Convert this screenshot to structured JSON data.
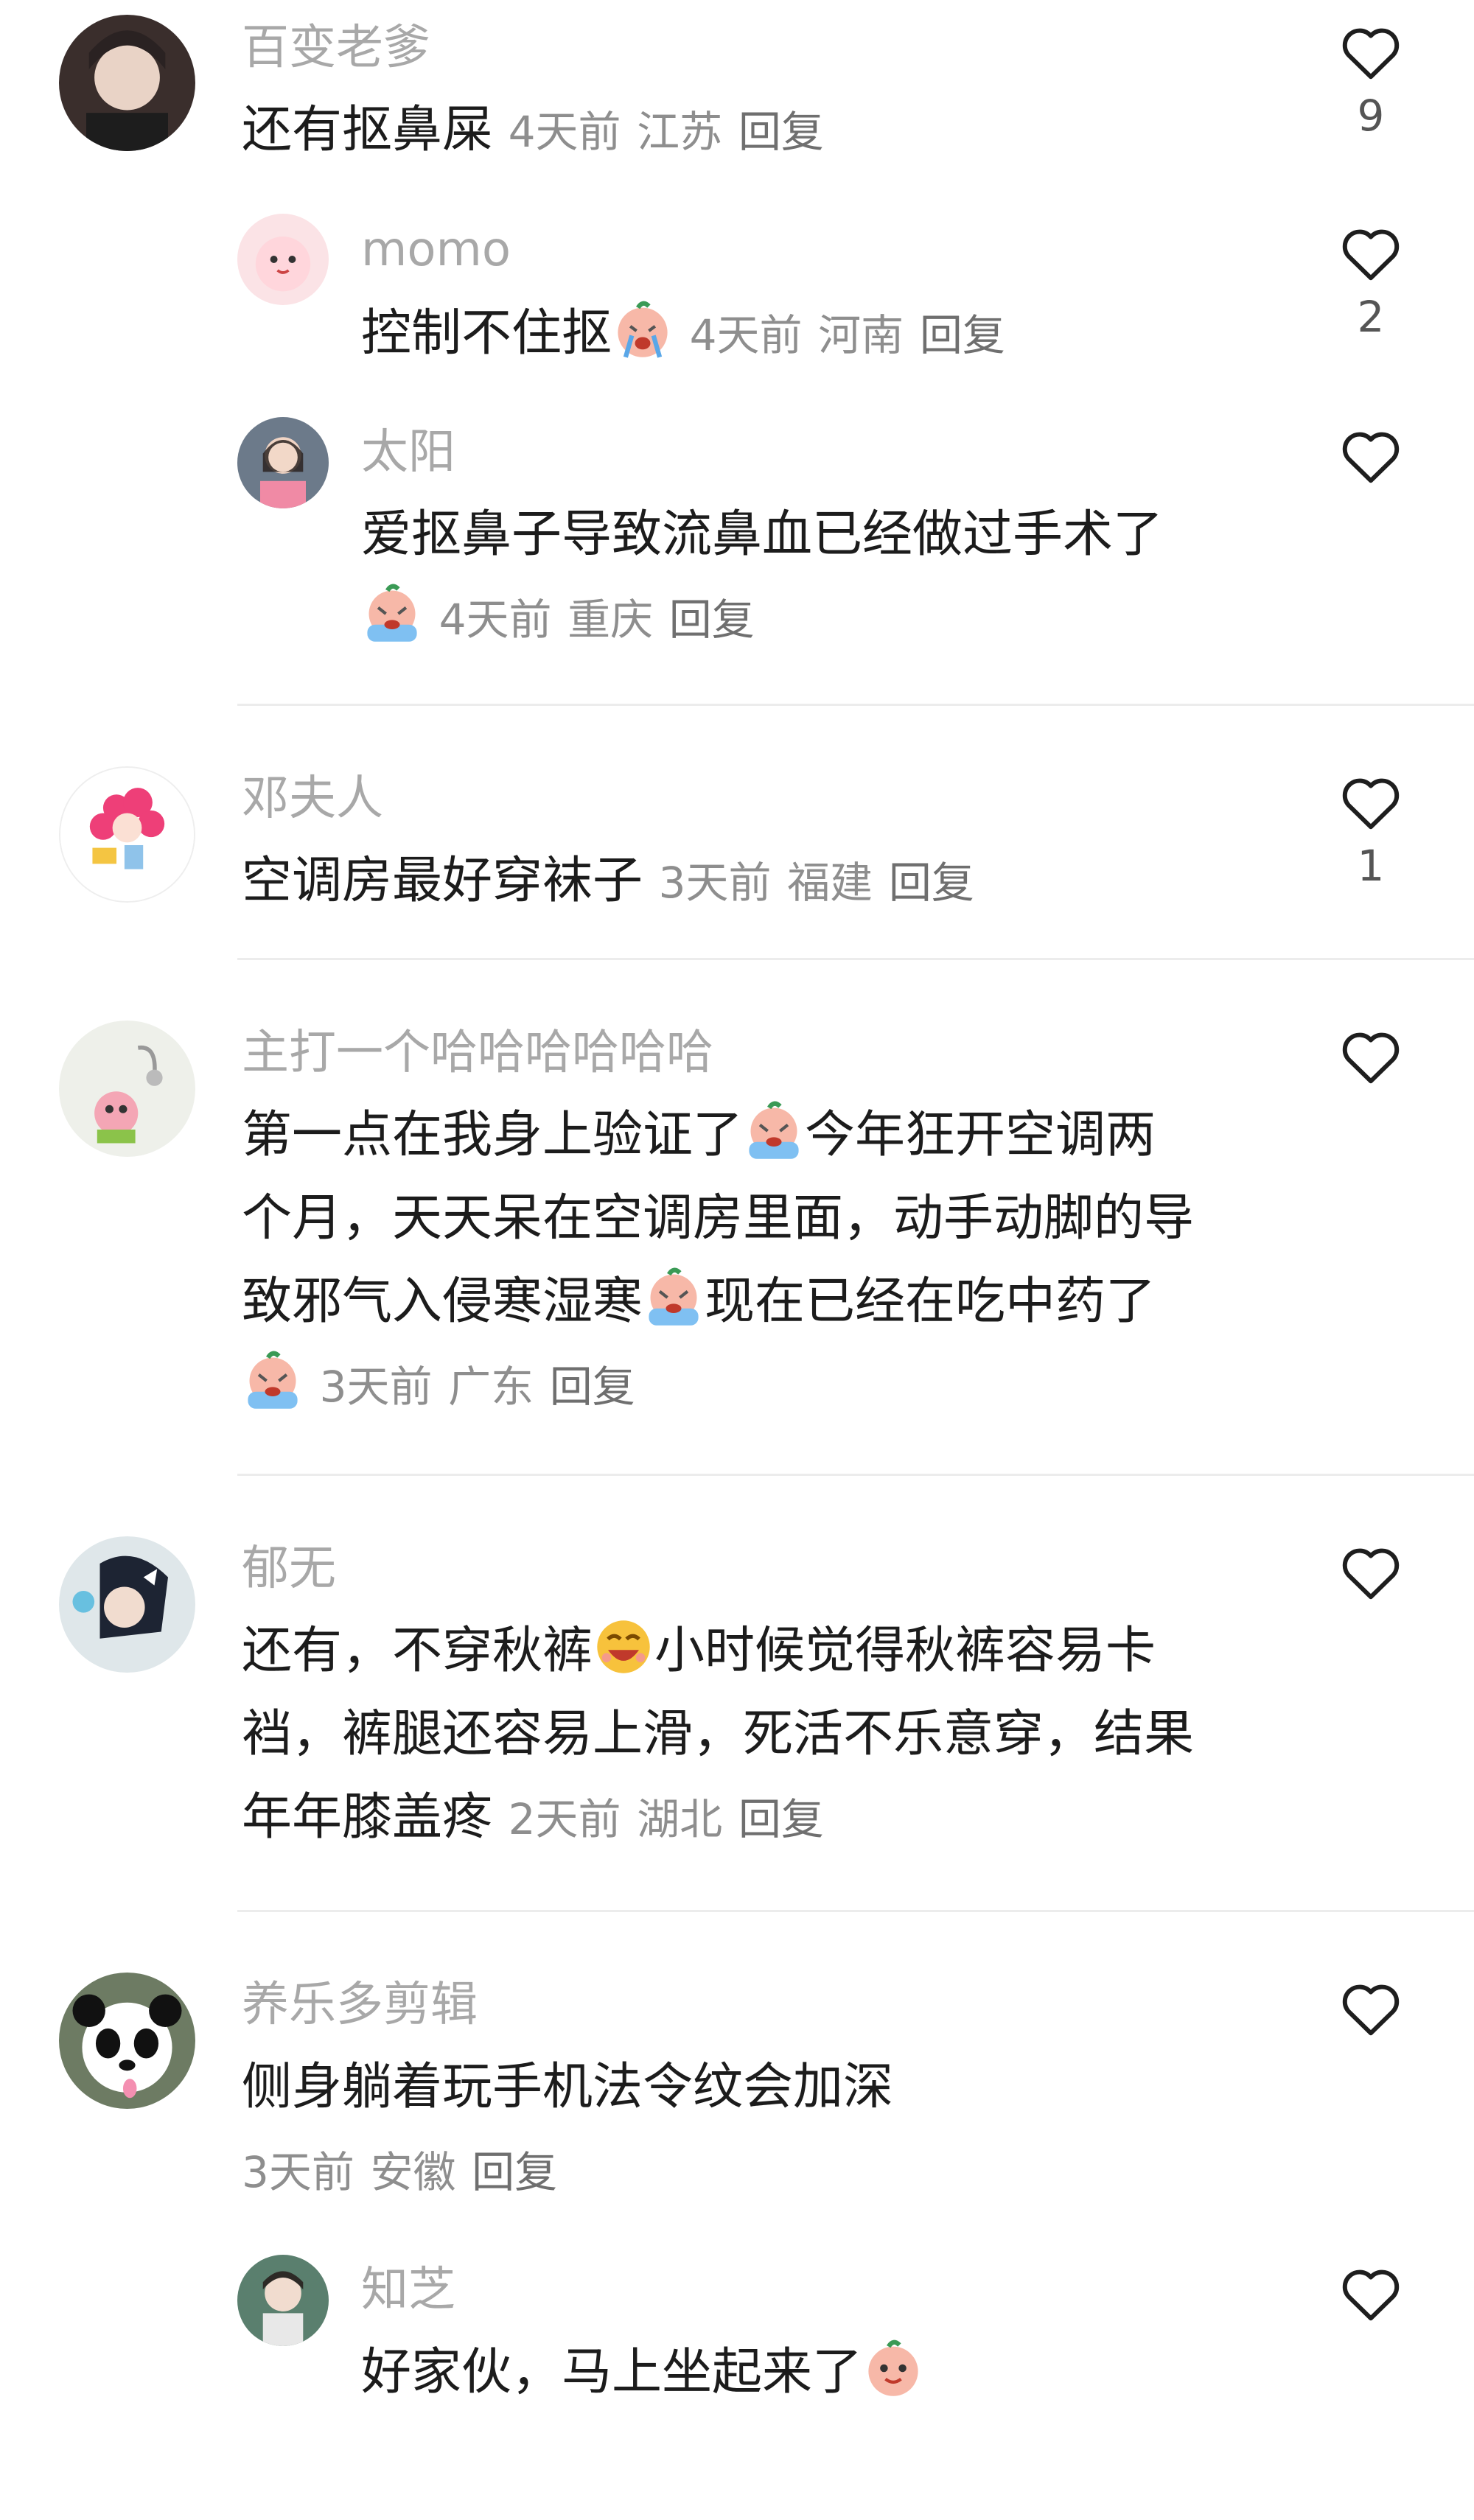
{
  "comments": [
    {
      "name": "百变老爹",
      "text": "还有抠鼻屎",
      "time": "4天前",
      "location": "江苏",
      "reply": "回复",
      "likes": "9"
    },
    {
      "name": "momo",
      "text": "控制不住抠",
      "time": "4天前",
      "location": "河南",
      "reply": "回复",
      "likes": "2"
    },
    {
      "name": "太阳",
      "text": "爱抠鼻子导致流鼻血已经做过手术了",
      "time": "4天前",
      "location": "重庆",
      "reply": "回复",
      "likes": ""
    },
    {
      "name": "邓夫人",
      "text": "空调房最好穿袜子",
      "time": "3天前",
      "location": "福建",
      "reply": "回复",
      "likes": "1"
    },
    {
      "name": "主打一个哈哈哈哈哈哈",
      "line1": "第一点在我身上验证了",
      "line1b": "今年狂开空调两",
      "line2": "个月，天天呆在空调房里面，动手动脚的导",
      "line3": "致邪气入侵寒湿寒",
      "line3b": "现在已经在吃中药了",
      "time": "3天前",
      "location": "广东",
      "reply": "回复",
      "likes": ""
    },
    {
      "name": "郁无",
      "line1": "还有，不穿秋裤",
      "line1b": "小时候觉得秋裤容易卡",
      "line2": "裆，裤腿还容易上滑，死活不乐意穿，结果",
      "line3": "年年膝盖疼",
      "time": "2天前",
      "location": "湖北",
      "reply": "回复",
      "likes": ""
    },
    {
      "name": "养乐多剪辑",
      "text": "侧身躺着玩手机法令纹会加深",
      "time": "3天前",
      "location": "安徽",
      "reply": "回复",
      "likes": ""
    },
    {
      "name": "知芝",
      "text": "好家伙，马上坐起来了",
      "likes": ""
    }
  ],
  "icons": {
    "like": "heart-outline-icon",
    "cry": "crying-emoji-icon",
    "laugh": "laughing-emoji-icon",
    "smile": "smile-emoji-icon"
  },
  "colors": {
    "name": "#a8a8a8",
    "text": "#1c1c1c",
    "meta": "#8e8e8e",
    "divider": "#ececec"
  }
}
